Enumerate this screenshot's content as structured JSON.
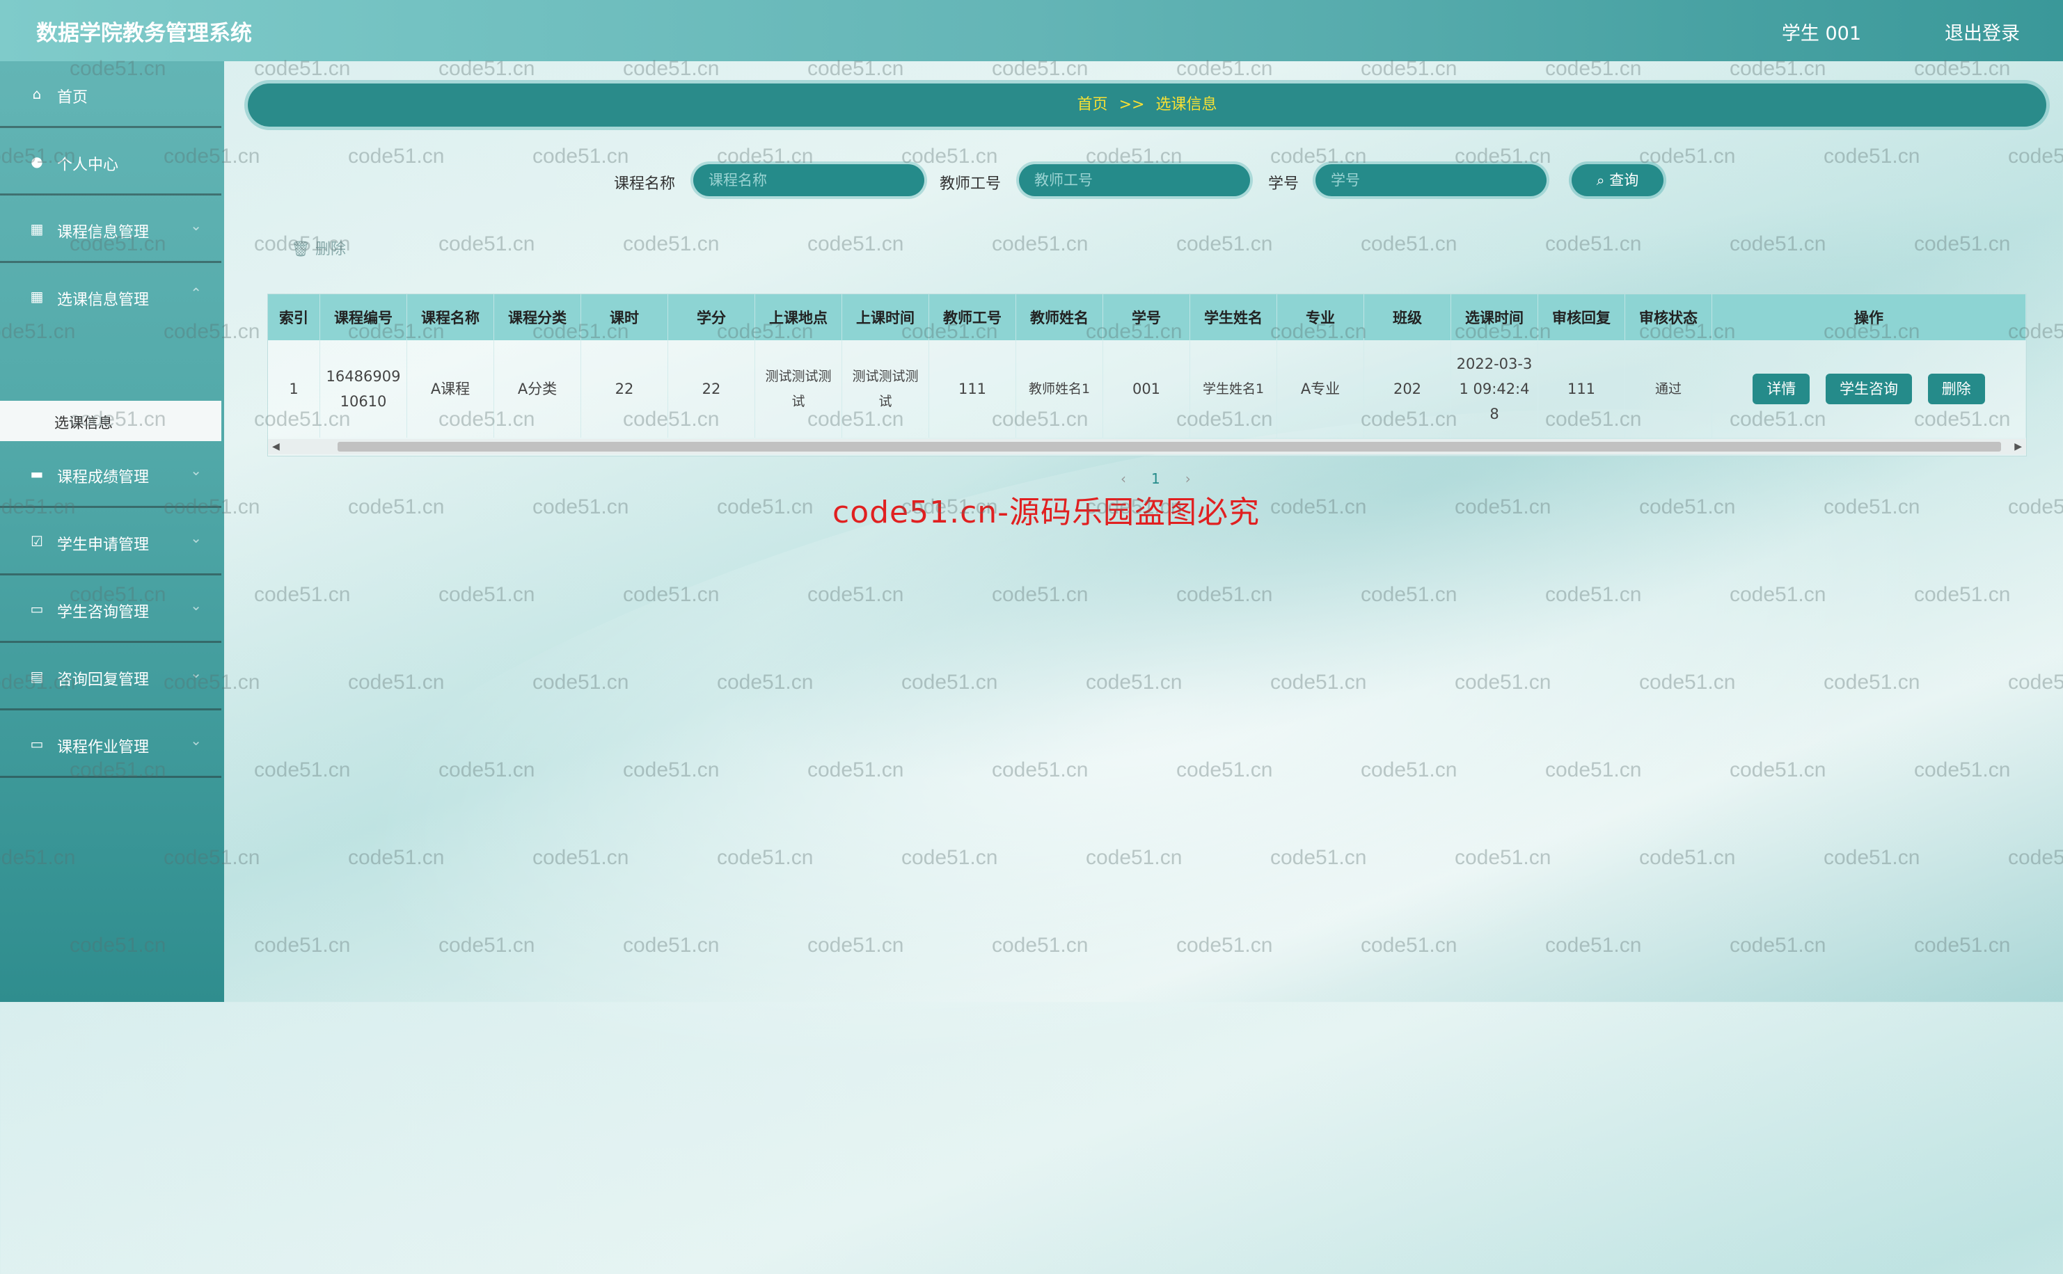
{
  "header": {
    "title": "数据学院教务管理系统",
    "user": "学生 001",
    "logout": "退出登录"
  },
  "sidebar": {
    "items": [
      {
        "label": "首页"
      },
      {
        "label": "个人中心"
      },
      {
        "label": "课程信息管理"
      },
      {
        "label": "选课信息管理"
      },
      {
        "label": "课程成绩管理"
      },
      {
        "label": "学生申请管理"
      },
      {
        "label": "学生咨询管理"
      },
      {
        "label": "咨询回复管理"
      },
      {
        "label": "课程作业管理"
      }
    ],
    "active_sub": "选课信息"
  },
  "breadcrumb": {
    "home": "首页",
    "sep": ">>",
    "current": "选课信息"
  },
  "search": {
    "course_label": "课程名称",
    "course_placeholder": "课程名称",
    "teacher_label": "教师工号",
    "teacher_placeholder": "教师工号",
    "student_label": "学号",
    "student_placeholder": "学号",
    "button": "查询"
  },
  "toolbar": {
    "delete": "删除"
  },
  "table": {
    "headers": [
      "索引",
      "课程编号",
      "课程名称",
      "课程分类",
      "课时",
      "学分",
      "上课地点",
      "上课时间",
      "教师工号",
      "教师姓名",
      "学号",
      "学生姓名",
      "专业",
      "班级",
      "选课时间",
      "审核回复",
      "审核状态",
      "操作"
    ],
    "rows": [
      {
        "cells": [
          "1",
          "1648690910610",
          "A课程",
          "A分类",
          "22",
          "22",
          "测试测试测试",
          "测试测试测试",
          "111",
          "教师姓名1",
          "001",
          "学生姓名1",
          "A专业",
          "202",
          "2022-03-31 09:42:48",
          "111",
          "通过"
        ]
      }
    ],
    "actions": [
      "详情",
      "学生咨询",
      "删除"
    ]
  },
  "pagination": {
    "prev": "‹",
    "page": "1",
    "next": "›"
  },
  "watermark": {
    "text": "code51.cn",
    "notice": "code51.cn-源码乐园盗图必究"
  }
}
